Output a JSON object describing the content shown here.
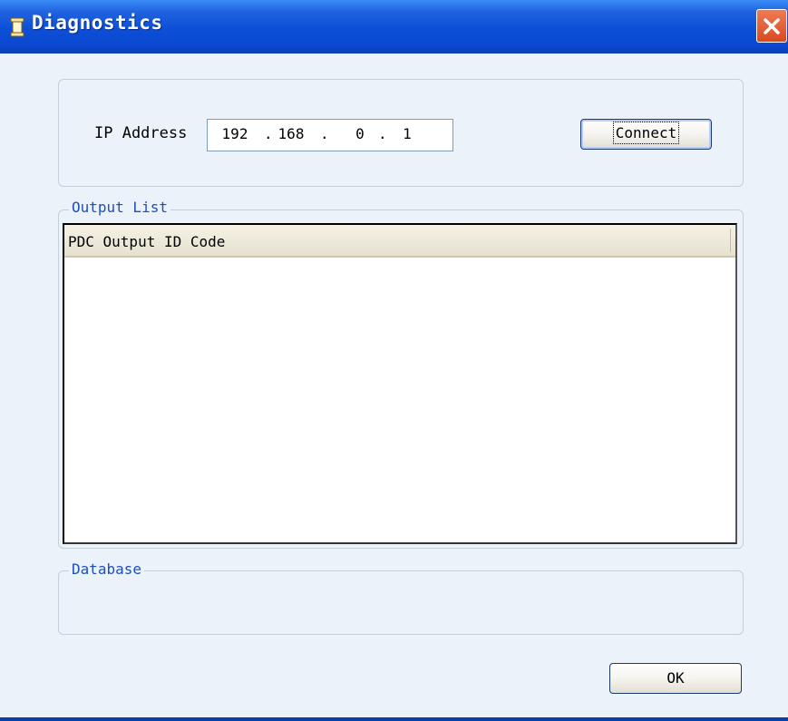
{
  "window": {
    "title": "Diagnostics",
    "title_icon": "app-scroll-icon",
    "close_icon": "close-icon",
    "colors": {
      "titlebar": "#0c4fd6",
      "close": "#d84a20",
      "group_label": "#1d4fbf",
      "body": "#ecf2f9"
    }
  },
  "connection": {
    "ip_label": "IP Address",
    "ip": {
      "o1": "192",
      "o2": "168",
      "o3": "0",
      "o4": "1",
      "sep": "."
    },
    "connect_label": "Connect"
  },
  "output_list": {
    "legend": "Output List",
    "column_header": "PDC Output ID Code",
    "rows": []
  },
  "database": {
    "legend": "Database"
  },
  "footer": {
    "ok_label": "OK"
  }
}
